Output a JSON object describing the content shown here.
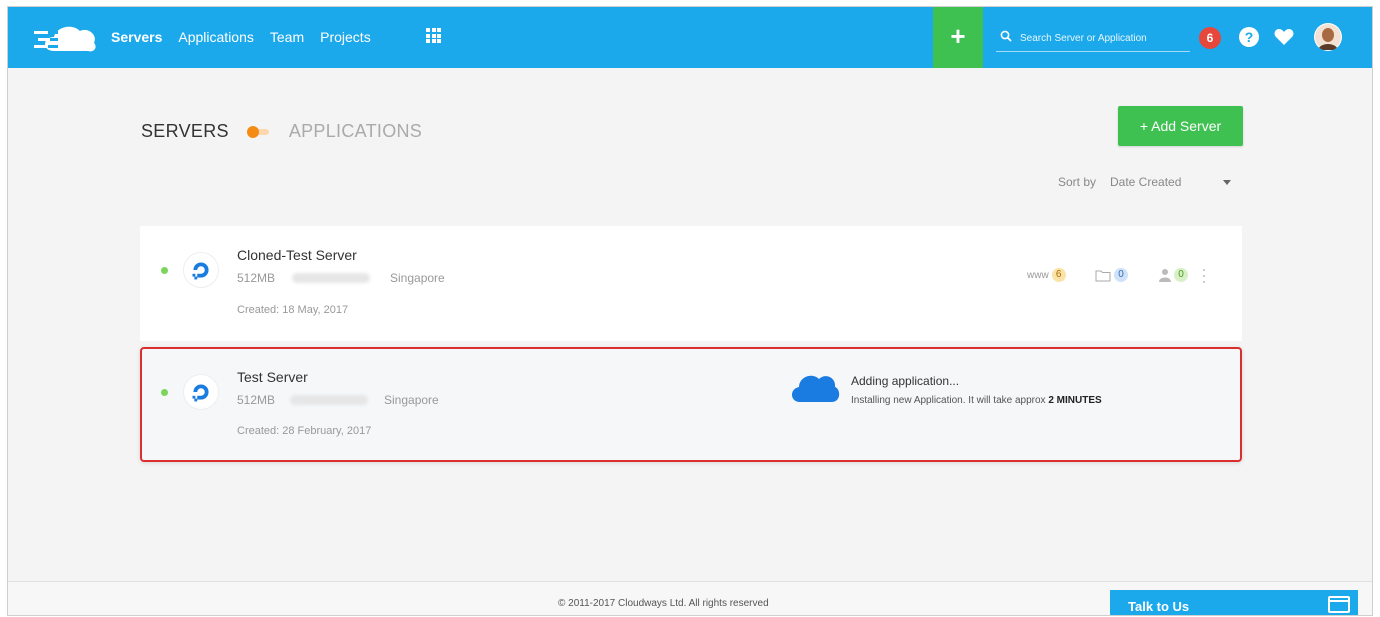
{
  "nav": {
    "items": [
      {
        "label": "Servers",
        "active": true
      },
      {
        "label": "Applications",
        "active": false
      },
      {
        "label": "Team",
        "active": false
      },
      {
        "label": "Projects",
        "active": false
      }
    ],
    "apps_icon": "grid-icon",
    "plus_label": "+",
    "search_placeholder": "Search Server or Application",
    "notification_count": "6",
    "help_label": "?",
    "accent": "#1ba9ec",
    "green": "#3fc152"
  },
  "header": {
    "servers_label": "SERVERS",
    "applications_label": "APPLICATIONS",
    "add_server_label": "+ Add Server",
    "sort_label": "Sort by",
    "sort_value": "Date Created"
  },
  "servers": [
    {
      "name": "Cloned-Test Server",
      "size": "512MB",
      "location": "Singapore",
      "created": "Created: 18 May, 2017",
      "stats": {
        "www": "www",
        "apps": "6",
        "folders": "0",
        "users": "0"
      }
    },
    {
      "name": "Test Server",
      "size": "512MB",
      "location": "Singapore",
      "created": "Created: 28 February, 2017",
      "progress_title": "Adding application...",
      "progress_text": "Installing new Application. It will take approx",
      "progress_time": "2 MINUTES"
    }
  ],
  "footer": {
    "copyright": "© 2011-2017 Cloudways Ltd. All rights reserved",
    "talk_label": "Talk to Us"
  }
}
